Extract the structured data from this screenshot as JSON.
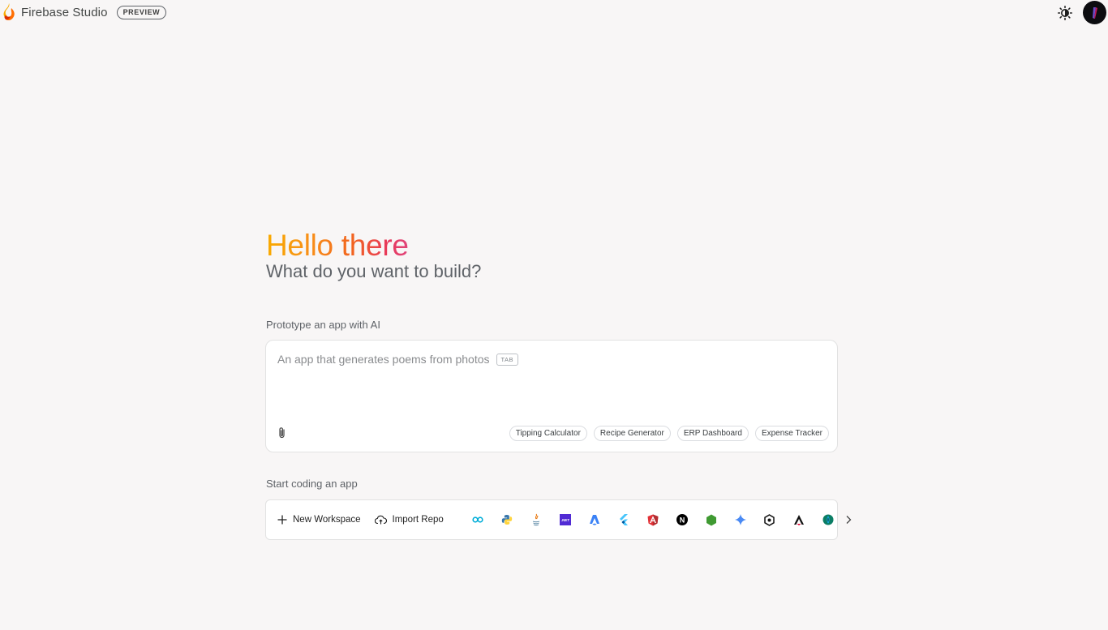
{
  "header": {
    "brand_name": "Firebase Studio",
    "badge": "PREVIEW",
    "theme_icon": "brightness-icon",
    "avatar_icon": "avatar"
  },
  "hero": {
    "greeting": "Hello there",
    "subtitle": "What do you want to build?"
  },
  "prototype": {
    "section_label": "Prototype an app with AI",
    "placeholder": "An app that generates poems from photos",
    "tab_hint": "TAB",
    "attach_icon": "paperclip-icon",
    "suggestions": [
      "Tipping Calculator",
      "Recipe Generator",
      "ERP Dashboard",
      "Expense Tracker"
    ]
  },
  "coding": {
    "section_label": "Start coding an app",
    "new_workspace": "New Workspace",
    "import_repo": "Import Repo",
    "templates": [
      {
        "name": "Go",
        "icon": "go-icon",
        "label": "∞",
        "color": "#00add8"
      },
      {
        "name": "Python",
        "icon": "python-icon",
        "label": "",
        "color": "#3776ab"
      },
      {
        "name": "Java",
        "icon": "java-icon",
        "label": "",
        "color": "#e76f00"
      },
      {
        "name": ".NET",
        "icon": "dotnet-icon",
        "label": ".NET",
        "color": "#512bd4"
      },
      {
        "name": "Astro",
        "icon": "astro-icon",
        "label": "",
        "color": "#3b82f6"
      },
      {
        "name": "Flutter",
        "icon": "flutter-icon",
        "label": "",
        "color": "#47c5fb"
      },
      {
        "name": "Angular",
        "icon": "angular-icon",
        "label": "",
        "color": "#dd0031"
      },
      {
        "name": "Next.js",
        "icon": "nextjs-icon",
        "label": "N",
        "color": "#000000"
      },
      {
        "name": "Node.js",
        "icon": "nodejs-icon",
        "label": "",
        "color": "#3f9a32"
      },
      {
        "name": "Gemini",
        "icon": "gemini-icon",
        "label": "",
        "color": "#4a8af4"
      },
      {
        "name": "Genkit",
        "icon": "genkit-icon",
        "label": "",
        "color": "#111111"
      },
      {
        "name": "Analog",
        "icon": "analog-icon",
        "label": "",
        "color": "#111111"
      },
      {
        "name": "Qwik",
        "icon": "qwik-icon",
        "label": "",
        "color": "#0b7d64"
      }
    ],
    "more_icon": "chevron-right-icon"
  }
}
